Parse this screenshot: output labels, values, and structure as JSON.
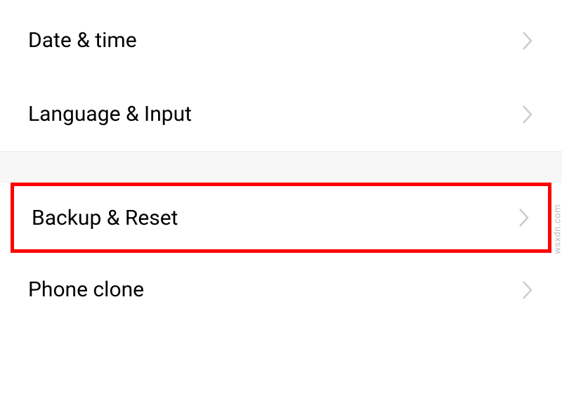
{
  "settings": {
    "group1": [
      {
        "label": "Date & time"
      },
      {
        "label": "Language & Input"
      }
    ],
    "group2": [
      {
        "label": "Backup & Reset",
        "highlighted": true
      },
      {
        "label": "Phone clone"
      }
    ]
  },
  "watermark": "wsxdn.com"
}
